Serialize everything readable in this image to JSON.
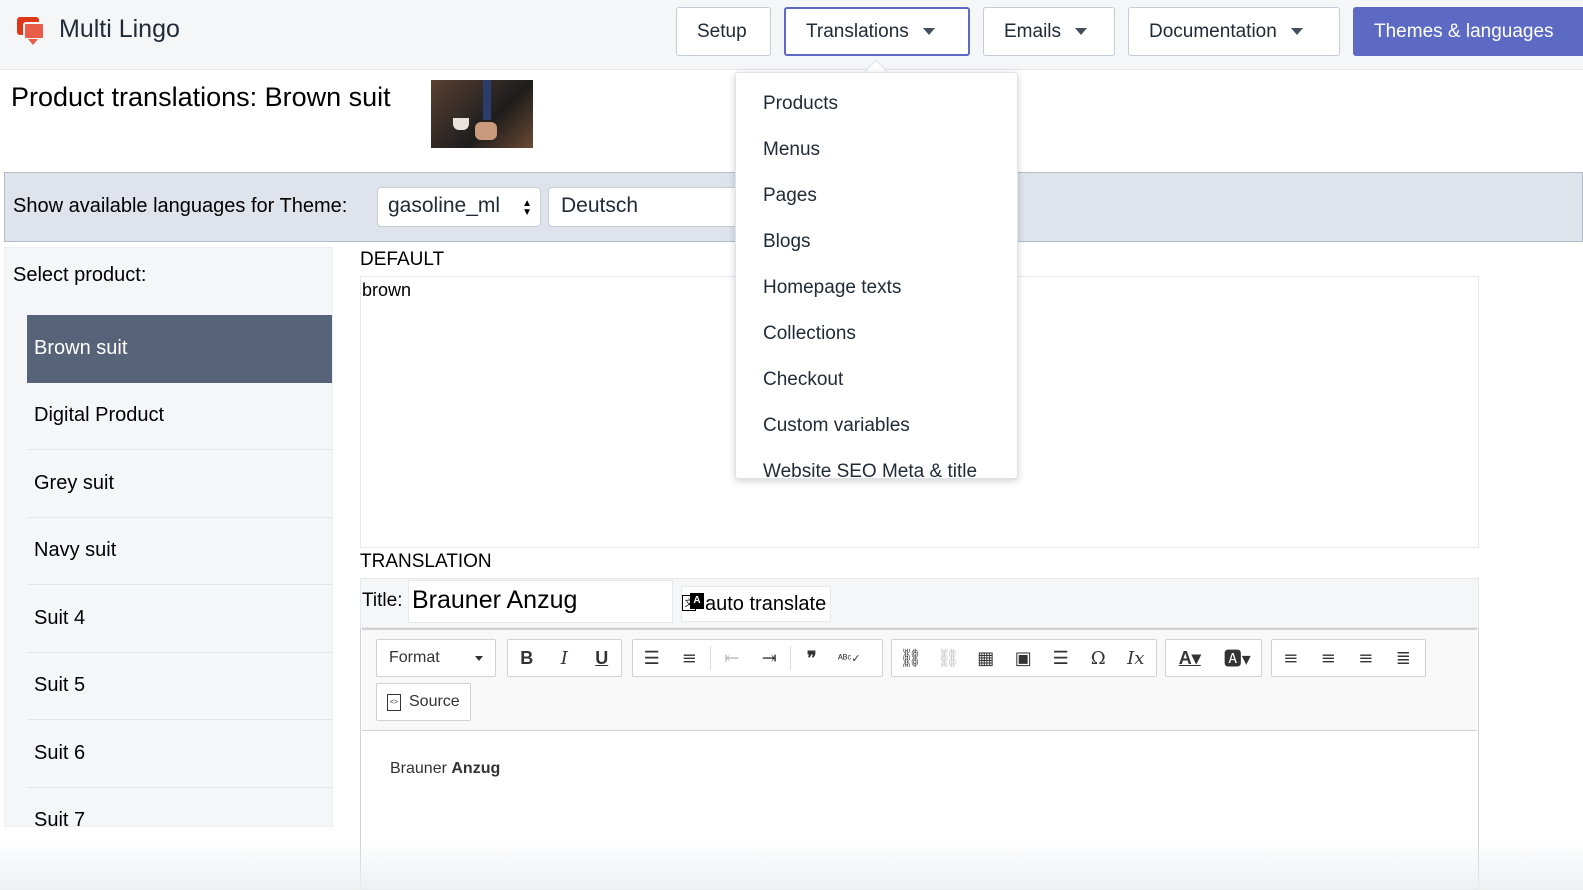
{
  "app": {
    "name": "Multi Lingo"
  },
  "nav": {
    "setup": "Setup",
    "translations": "Translations",
    "emails": "Emails",
    "documentation": "Documentation",
    "themes": "Themes & languages"
  },
  "page": {
    "title": "Product translations: Brown suit"
  },
  "theme_bar": {
    "label": "Show available languages for Theme:",
    "theme_value": "gasoline_ml",
    "language_value": "Deutsch"
  },
  "sidebar": {
    "heading": "Select product:",
    "products": [
      "Brown suit",
      "Digital Product",
      "Grey suit",
      "Navy suit",
      "Suit 4",
      "Suit 5",
      "Suit 6",
      "Suit 7"
    ],
    "selected": "Brown suit"
  },
  "default_section": {
    "label": "DEFAULT",
    "content": "brown"
  },
  "translation_section": {
    "label": "TRANSLATION",
    "title_label": "Title:",
    "title_value": "Brauner Anzug",
    "auto_translate": "auto translate"
  },
  "editor": {
    "format_label": "Format",
    "source_label": "Source",
    "content_plain": "Brauner",
    "content_bold": "Anzug"
  },
  "dropdown": {
    "items": [
      "Products",
      "Menus",
      "Pages",
      "Blogs",
      "Homepage texts",
      "Collections",
      "Checkout",
      "Custom variables",
      "Website SEO Meta & title"
    ]
  },
  "colors": {
    "primary": "#5c6ac4",
    "selected_item": "#576378",
    "logo": "#de3618"
  }
}
